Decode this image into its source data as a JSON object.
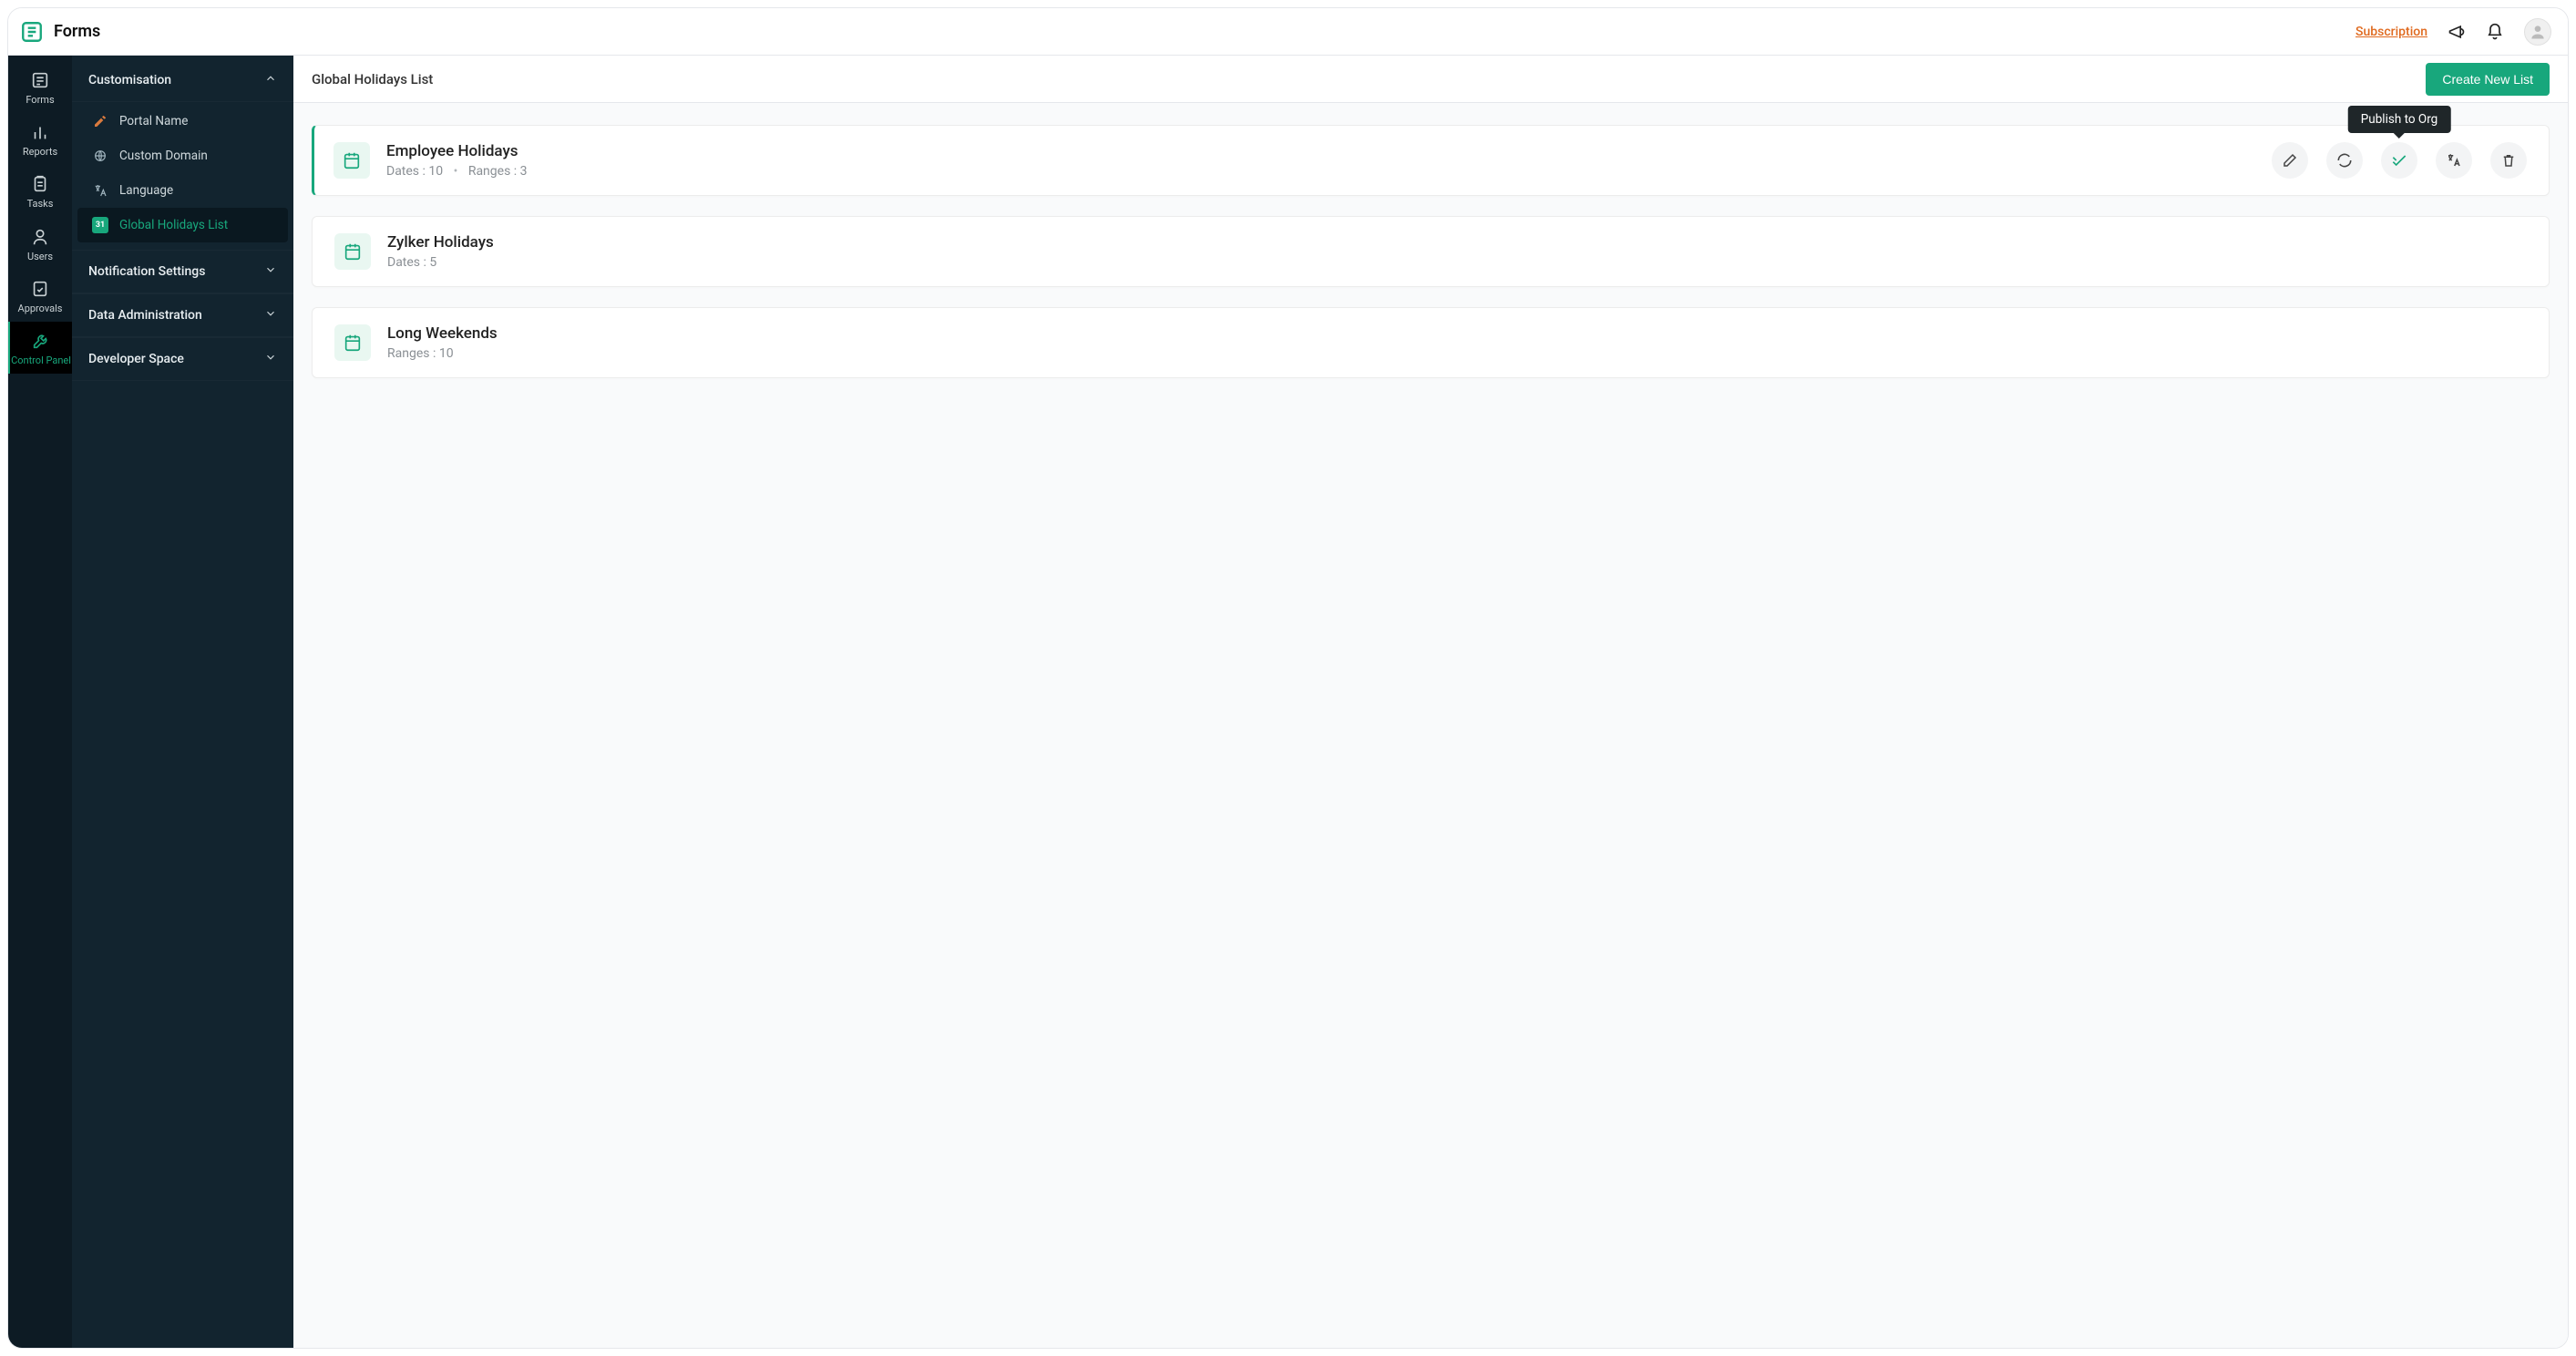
{
  "brand": {
    "name": "Forms"
  },
  "header": {
    "subscription_label": "Subscription"
  },
  "rail": {
    "items": [
      {
        "label": "Forms"
      },
      {
        "label": "Reports"
      },
      {
        "label": "Tasks"
      },
      {
        "label": "Users"
      },
      {
        "label": "Approvals"
      },
      {
        "label": "Control Panel"
      }
    ]
  },
  "side_panel": {
    "sections": [
      {
        "label": "Customisation",
        "expanded": true,
        "items": [
          {
            "label": "Portal Name"
          },
          {
            "label": "Custom Domain"
          },
          {
            "label": "Language"
          },
          {
            "label": "Global Holidays List",
            "badge": "31"
          }
        ]
      },
      {
        "label": "Notification Settings",
        "expanded": false
      },
      {
        "label": "Data Administration",
        "expanded": false
      },
      {
        "label": "Developer Space",
        "expanded": false
      }
    ]
  },
  "main": {
    "title": "Global Holidays List",
    "create_btn": "Create New List",
    "tooltip_publish": "Publish to Org",
    "lists": [
      {
        "title": "Employee Holidays",
        "dates_label": "Dates : 10",
        "ranges_label": "Ranges : 3",
        "show_actions": true
      },
      {
        "title": "Zylker Holidays",
        "dates_label": "Dates : 5"
      },
      {
        "title": "Long Weekends",
        "ranges_label": "Ranges : 10"
      }
    ]
  }
}
